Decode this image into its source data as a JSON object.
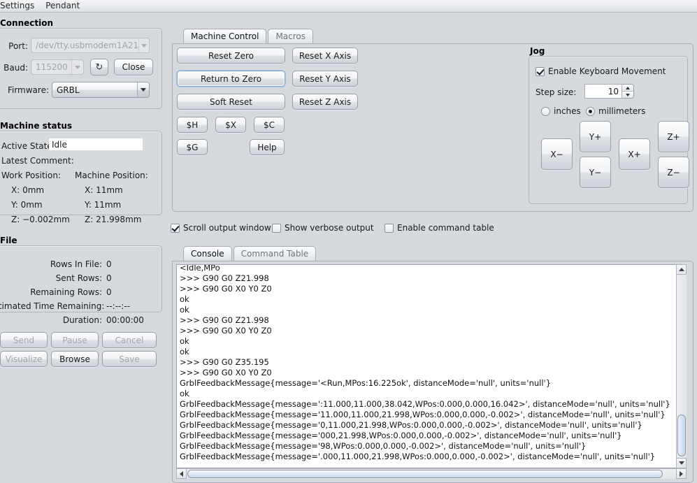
{
  "menubar": {
    "items": [
      {
        "label": "Settings"
      },
      {
        "label": "Pendant"
      }
    ]
  },
  "connection": {
    "title": "Connection",
    "port_label": "Port:",
    "port_value": "/dev/tty.usbmodem1A21",
    "baud_label": "Baud:",
    "baud_value": "115200",
    "refresh_icon": "↻",
    "close_label": "Close",
    "firmware_label": "Firmware:",
    "firmware_value": "GRBL"
  },
  "machine_status": {
    "title": "Machine status",
    "active_state_label": "Active State:",
    "active_state_value": "Idle",
    "latest_comment_label": "Latest Comment:",
    "latest_comment_value": "",
    "work_position_label": "Work Position:",
    "machine_position_label": "Machine Position:",
    "work": {
      "x": "X: 0mm",
      "y": "Y: 0mm",
      "z": "Z: −0.002mm"
    },
    "machine": {
      "x": "X: 11mm",
      "y": "Y: 11mm",
      "z": "Z: 21.998mm"
    }
  },
  "file": {
    "title": "File",
    "rows_in_file_label": "Rows In File:",
    "rows_in_file_value": "0",
    "sent_rows_label": "Sent Rows:",
    "sent_rows_value": "0",
    "remaining_rows_label": "Remaining Rows:",
    "remaining_rows_value": "0",
    "eta_label": "Estimated Time Remaining:",
    "eta_value": "--:--:--",
    "duration_label": "Duration:",
    "duration_value": "00:00:00",
    "buttons": {
      "send": "Send",
      "pause": "Pause",
      "cancel": "Cancel",
      "visualize": "Visualize",
      "browse": "Browse",
      "save": "Save"
    }
  },
  "control_tabs": {
    "machine_control": "Machine Control",
    "macros": "Macros"
  },
  "machine_control": {
    "reset_zero": "Reset Zero",
    "return_to_zero": "Return to Zero",
    "soft_reset": "Soft Reset",
    "reset_x": "Reset X Axis",
    "reset_y": "Reset Y Axis",
    "reset_z": "Reset Z Axis",
    "cmd_h": "$H",
    "cmd_x": "$X",
    "cmd_c": "$C",
    "cmd_g": "$G",
    "help": "Help"
  },
  "jog": {
    "title": "Jog",
    "enable_keyboard": "Enable Keyboard Movement",
    "enable_keyboard_checked": true,
    "step_size_label": "Step size:",
    "step_size_value": "10",
    "unit_inches": "inches",
    "unit_millimeters": "millimeters",
    "unit_selected": "millimeters",
    "buttons": {
      "x_minus": "X−",
      "x_plus": "X+",
      "y_plus": "Y+",
      "y_minus": "Y−",
      "z_plus": "Z+",
      "z_minus": "Z−"
    }
  },
  "output_options": {
    "scroll_output_window": "Scroll output window",
    "scroll_output_window_checked": true,
    "show_verbose_output": "Show verbose output",
    "show_verbose_output_checked": false,
    "enable_command_table": "Enable command table",
    "enable_command_table_checked": false
  },
  "console_tabs": {
    "console": "Console",
    "command_table": "Command Table"
  },
  "console": {
    "lines": [
      "<Idle,MPo",
      ">>> G90 G0 Z21.998",
      ">>> G90 G0 X0 Y0 Z0",
      "ok",
      "ok",
      ">>> G90 G0 Z21.998",
      ">>> G90 G0 X0 Y0 Z0",
      "ok",
      "ok",
      ">>> G90 G0 Z35.195",
      ">>> G90 G0 X0 Y0 Z0",
      "GrblFeedbackMessage{message='<Run,MPos:16.225ok', distanceMode='null', units='null'}",
      "ok",
      "GrblFeedbackMessage{message=':11.000,11.000,38.042,WPos:0.000,0.000,16.042>', distanceMode='null', units='null'}",
      "GrblFeedbackMessage{message='11.000,11.000,21.998,WPos:0.000,0.000,-0.002>', distanceMode='null', units='null'}",
      "GrblFeedbackMessage{message='0,11.000,21.998,WPos:0.000,0.000,-0.002>', distanceMode='null', units='null'}",
      "GrblFeedbackMessage{message='000,21.998,WPos:0.000,0.000,-0.002>', distanceMode='null', units='null'}",
      "GrblFeedbackMessage{message='98,WPos:0.000,0.000,-0.002>', distanceMode='null', units='null'}",
      "GrblFeedbackMessage{message='.000,11.000,21.998,WPos:0.000,0.000,-0.002>', distanceMode='null', units='null'}"
    ]
  }
}
